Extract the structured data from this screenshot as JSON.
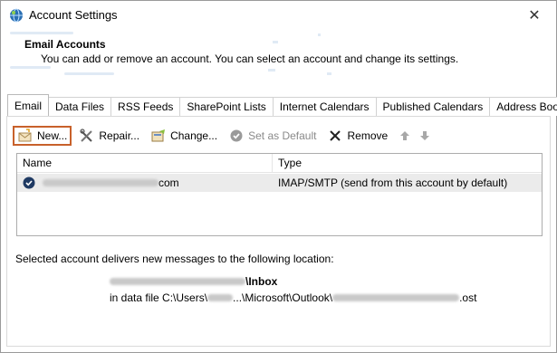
{
  "window": {
    "title": "Account Settings",
    "close_glyph": "✕"
  },
  "header": {
    "title": "Email Accounts",
    "description": "You can add or remove an account. You can select an account and change its settings."
  },
  "tabs": [
    {
      "label": "Email",
      "active": true
    },
    {
      "label": "Data Files"
    },
    {
      "label": "RSS Feeds"
    },
    {
      "label": "SharePoint Lists"
    },
    {
      "label": "Internet Calendars"
    },
    {
      "label": "Published Calendars"
    },
    {
      "label": "Address Books"
    }
  ],
  "toolbar": {
    "new_label": "New...",
    "repair_label": "Repair...",
    "change_label": "Change...",
    "default_label": "Set as Default",
    "remove_label": "Remove"
  },
  "accounts": {
    "columns": {
      "name": "Name",
      "type": "Type"
    },
    "rows": [
      {
        "name_suffix": "com",
        "type": "IMAP/SMTP (send from this account by default)"
      }
    ]
  },
  "delivery": {
    "label": "Selected account delivers new messages to the following location:",
    "inbox_suffix": "\\Inbox",
    "file_prefix": "in data file C:\\Users\\",
    "file_middle": "...\\Microsoft\\Outlook\\",
    "file_suffix": ".ost"
  },
  "colors": {
    "highlight": "#c8612b",
    "selected_row": "#ebebeb"
  },
  "icons": {
    "app": "outlook-globe-icon",
    "new": "new-account-icon",
    "repair": "repair-icon",
    "change": "change-icon",
    "default": "set-default-icon",
    "remove": "remove-x-icon",
    "up": "move-up-arrow-icon",
    "down": "move-down-arrow-icon",
    "account": "default-account-check-icon"
  }
}
